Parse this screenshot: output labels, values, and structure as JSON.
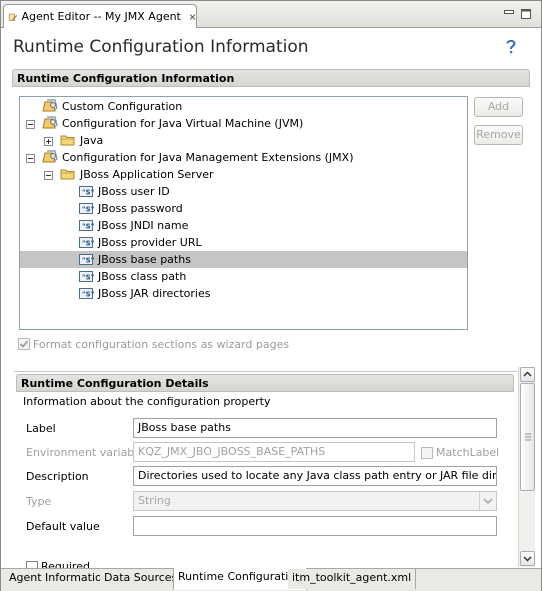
{
  "editor_tab": {
    "title": "Agent Editor -- My JMX Agent"
  },
  "page": {
    "title": "Runtime Configuration Information"
  },
  "section": {
    "title": "Runtime Configuration Information"
  },
  "tree": {
    "items": [
      {
        "label": "Custom Configuration",
        "icon": "config-icon"
      },
      {
        "label": "Configuration for Java Virtual Machine (JVM)",
        "icon": "config-icon"
      },
      {
        "label": "Java",
        "icon": "folder-icon"
      },
      {
        "label": "Configuration for Java Management Extensions (JMX)",
        "icon": "config-icon"
      },
      {
        "label": "JBoss Application Server",
        "icon": "folder-icon"
      },
      {
        "label": "JBoss user ID",
        "icon": "string-property-icon"
      },
      {
        "label": "JBoss password",
        "icon": "string-property-icon"
      },
      {
        "label": "JBoss JNDI name",
        "icon": "string-property-icon"
      },
      {
        "label": "JBoss provider URL",
        "icon": "string-property-icon"
      },
      {
        "label": "JBoss base paths",
        "icon": "string-property-icon",
        "selected": true
      },
      {
        "label": "JBoss class path",
        "icon": "string-property-icon"
      },
      {
        "label": "JBoss JAR directories",
        "icon": "string-property-icon"
      }
    ]
  },
  "buttons": {
    "add": "Add",
    "remove": "Remove"
  },
  "wizard_checkbox": {
    "label": "Format configuration sections as wizard pages",
    "checked": true
  },
  "details": {
    "title": "Runtime Configuration Details",
    "description": "Information about the configuration property",
    "label_label": "Label",
    "label_value": "JBoss base paths",
    "env_label": "Environment variable",
    "env_value": "KQZ_JMX_JBO_JBOSS_BASE_PATHS",
    "matchlabel": "MatchLabel",
    "desc_label": "Description",
    "desc_value": "Directories used to locate any Java class path entry or JAR file directory w",
    "type_label": "Type",
    "type_value": "String",
    "default_label": "Default value",
    "default_value": "",
    "required_label": "Required"
  },
  "bottom_tabs": [
    {
      "label": "Agent Information"
    },
    {
      "label": "Data Sources"
    },
    {
      "label": "Runtime Configuration",
      "active": true
    },
    {
      "label": "itm_toolkit_agent.xml"
    }
  ],
  "colors": {
    "selection": "#c5c5c5",
    "section_bar": "#dcdad5"
  }
}
